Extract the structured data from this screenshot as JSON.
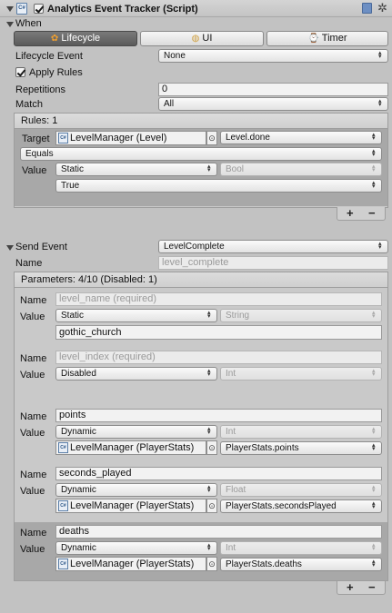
{
  "component": {
    "title": "Analytics Event Tracker (Script)",
    "enabled": true
  },
  "when": {
    "section_label": "When",
    "tabs": [
      {
        "label": "Lifecycle",
        "active": true
      },
      {
        "label": "UI",
        "active": false
      },
      {
        "label": "Timer",
        "active": false
      }
    ],
    "lifecycle_event_label": "Lifecycle Event",
    "lifecycle_event_value": "None",
    "apply_rules_label": "Apply Rules",
    "apply_rules_checked": true,
    "repetitions_label": "Repetitions",
    "repetitions_value": "0",
    "match_label": "Match",
    "match_value": "All",
    "rules": {
      "header": "Rules: 1",
      "target_label": "Target",
      "target_object": "LevelManager (Level)",
      "target_property": "Level.done",
      "comparison": "Equals",
      "value_label": "Value",
      "value_mode": "Static",
      "value_type": "Bool",
      "value": "True",
      "plus": "+",
      "minus": "−"
    }
  },
  "send_event": {
    "label": "Send Event",
    "value": "LevelComplete",
    "name_label": "Name",
    "name_value": "level_complete",
    "params_header": "Parameters: 4/10 (Disabled: 1)",
    "params": [
      {
        "name_label": "Name",
        "name": "level_name (required)",
        "name_is_placeholder": true,
        "value_label": "Value",
        "mode": "Static",
        "type": "String",
        "static_value": "gothic_church"
      },
      {
        "name_label": "Name",
        "name": "level_index (required)",
        "name_is_placeholder": true,
        "value_label": "Value",
        "mode": "Disabled",
        "type": "Int"
      },
      {
        "name_label": "Name",
        "name": "points",
        "value_label": "Value",
        "mode": "Dynamic",
        "type": "Int",
        "object": "LevelManager (PlayerStats)",
        "property": "PlayerStats.points"
      },
      {
        "name_label": "Name",
        "name": "seconds_played",
        "value_label": "Value",
        "mode": "Dynamic",
        "type": "Float",
        "object": "LevelManager (PlayerStats)",
        "property": "PlayerStats.secondsPlayed"
      },
      {
        "name_label": "Name",
        "name": "deaths",
        "value_label": "Value",
        "mode": "Dynamic",
        "type": "Int",
        "object": "LevelManager (PlayerStats)",
        "property": "PlayerStats.deaths"
      }
    ],
    "plus": "+",
    "minus": "−"
  },
  "icons": {
    "script": "C#",
    "target": "⊙",
    "arrow": "▲▼",
    "gear": "✲",
    "lifecycle": "✿",
    "ui": "◍",
    "timer": "⌚"
  },
  "colors": {
    "background": "#c2c2c2",
    "active_tab": "#5a5a5a",
    "selected_row": "#a8a8a8"
  }
}
